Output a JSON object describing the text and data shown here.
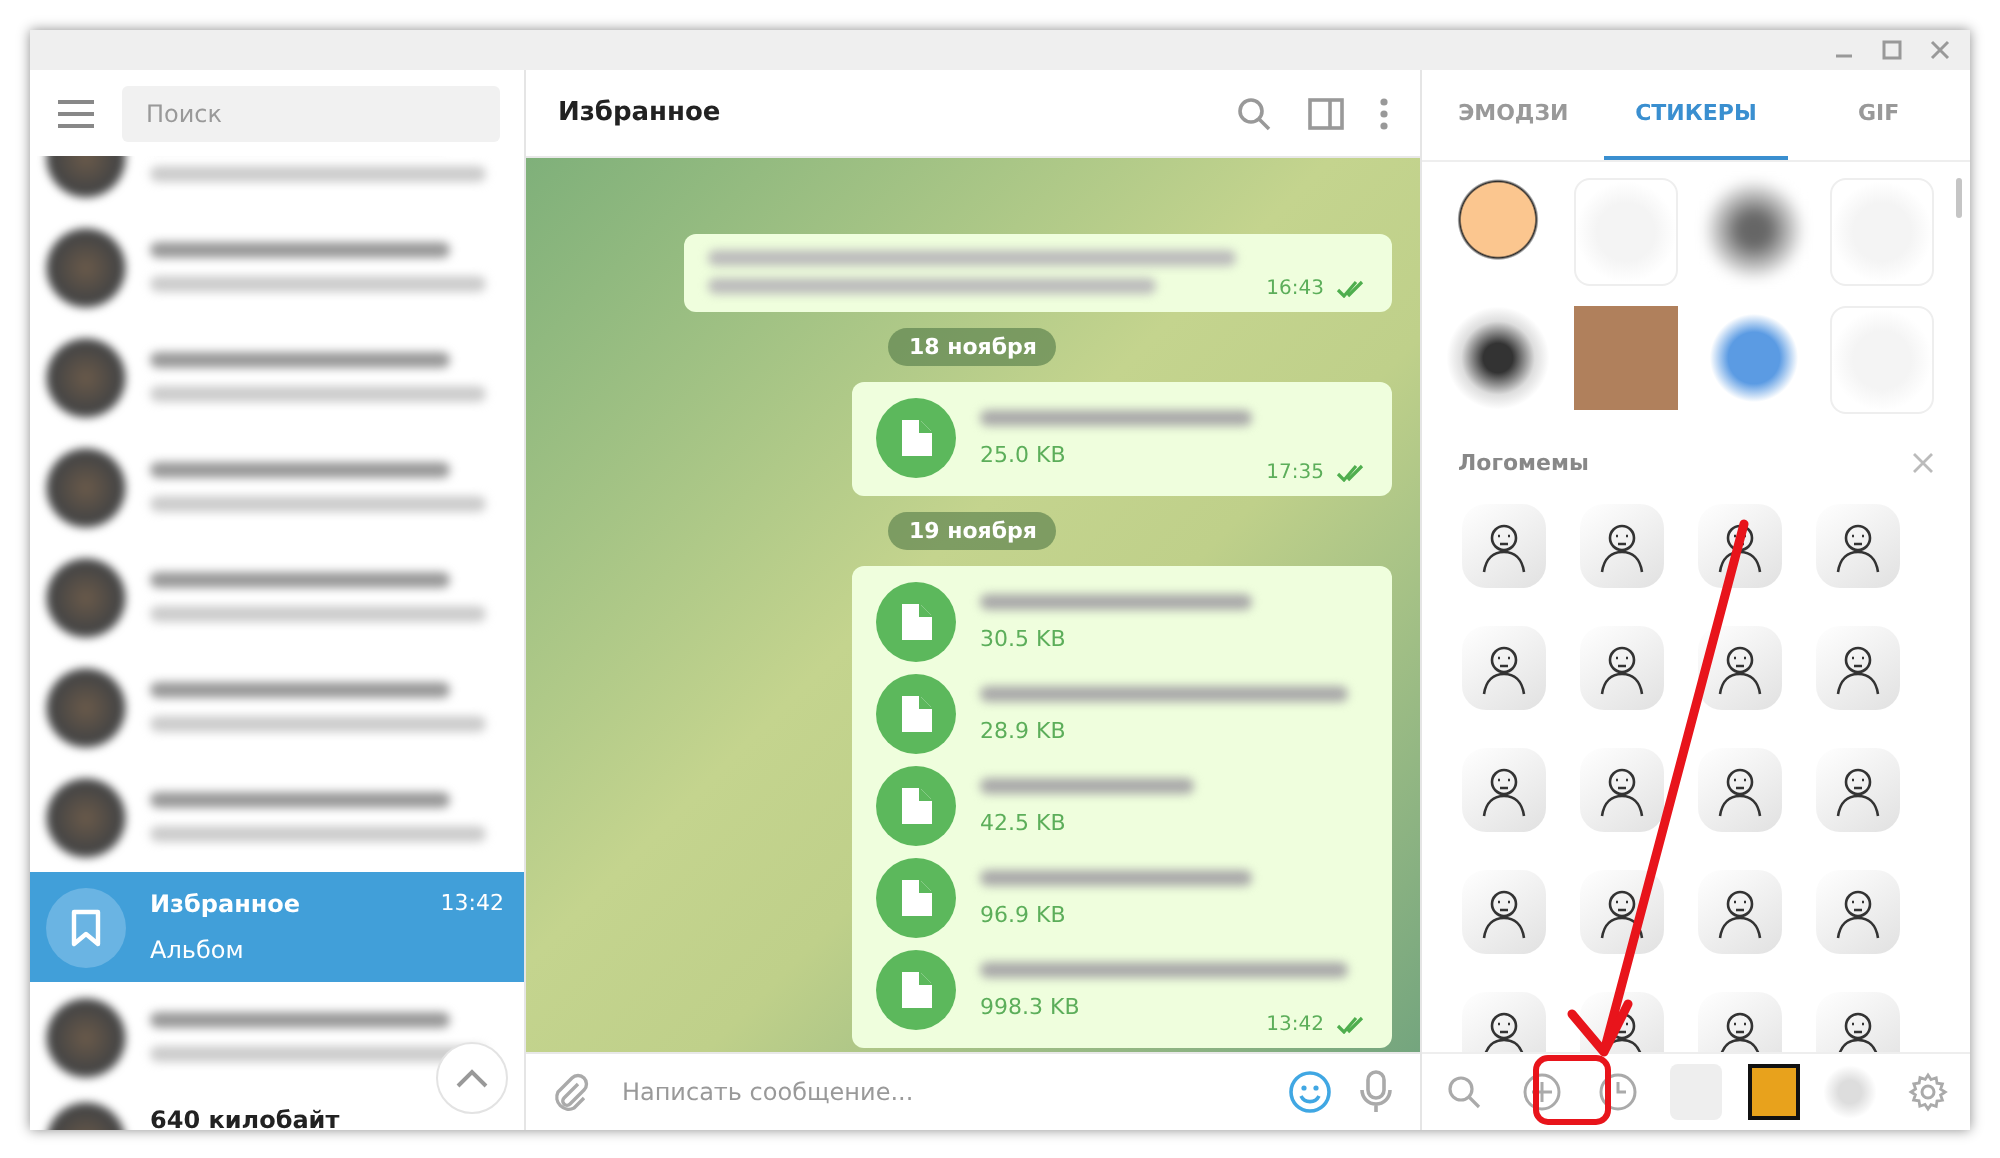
{
  "sidebar": {
    "search": {
      "placeholder": "Поиск"
    },
    "chats": [
      {
        "kind": "blurred",
        "selected": false
      },
      {
        "kind": "blurred",
        "selected": false
      },
      {
        "kind": "blurred",
        "selected": false
      },
      {
        "kind": "blurred",
        "selected": false
      },
      {
        "kind": "blurred",
        "selected": false
      },
      {
        "kind": "blurred",
        "selected": false
      },
      {
        "kind": "blurred",
        "selected": false
      },
      {
        "kind": "saved",
        "title": "Избранное",
        "time": "13:42",
        "preview": "Альбом",
        "selected": true
      },
      {
        "kind": "blurred",
        "selected": false
      },
      {
        "kind": "plain",
        "title": "640 килобайт",
        "selected": false
      }
    ]
  },
  "chat": {
    "title": "Избранное",
    "messages": [
      {
        "kind": "text",
        "time": "16:43",
        "read": true
      },
      {
        "kind": "date",
        "label": "18 ноября"
      },
      {
        "kind": "files",
        "files": [
          {
            "size": "25.0 KB"
          }
        ],
        "time": "17:35",
        "read": true
      },
      {
        "kind": "date",
        "label": "19 ноября"
      },
      {
        "kind": "files",
        "files": [
          {
            "size": "30.5 KB"
          },
          {
            "size": "28.9 KB"
          },
          {
            "size": "42.5 KB"
          },
          {
            "size": "96.9 KB"
          },
          {
            "size": "998.3 KB"
          }
        ],
        "time": "13:42",
        "read": true
      }
    ],
    "composer": {
      "placeholder": "Написать сообщение..."
    }
  },
  "panel": {
    "tabs": [
      {
        "label": "ЭМОДЗИ",
        "selected": false
      },
      {
        "label": "СТИКЕРЫ",
        "selected": true
      },
      {
        "label": "GIF",
        "selected": false
      }
    ],
    "section_title": "Логомемы"
  }
}
